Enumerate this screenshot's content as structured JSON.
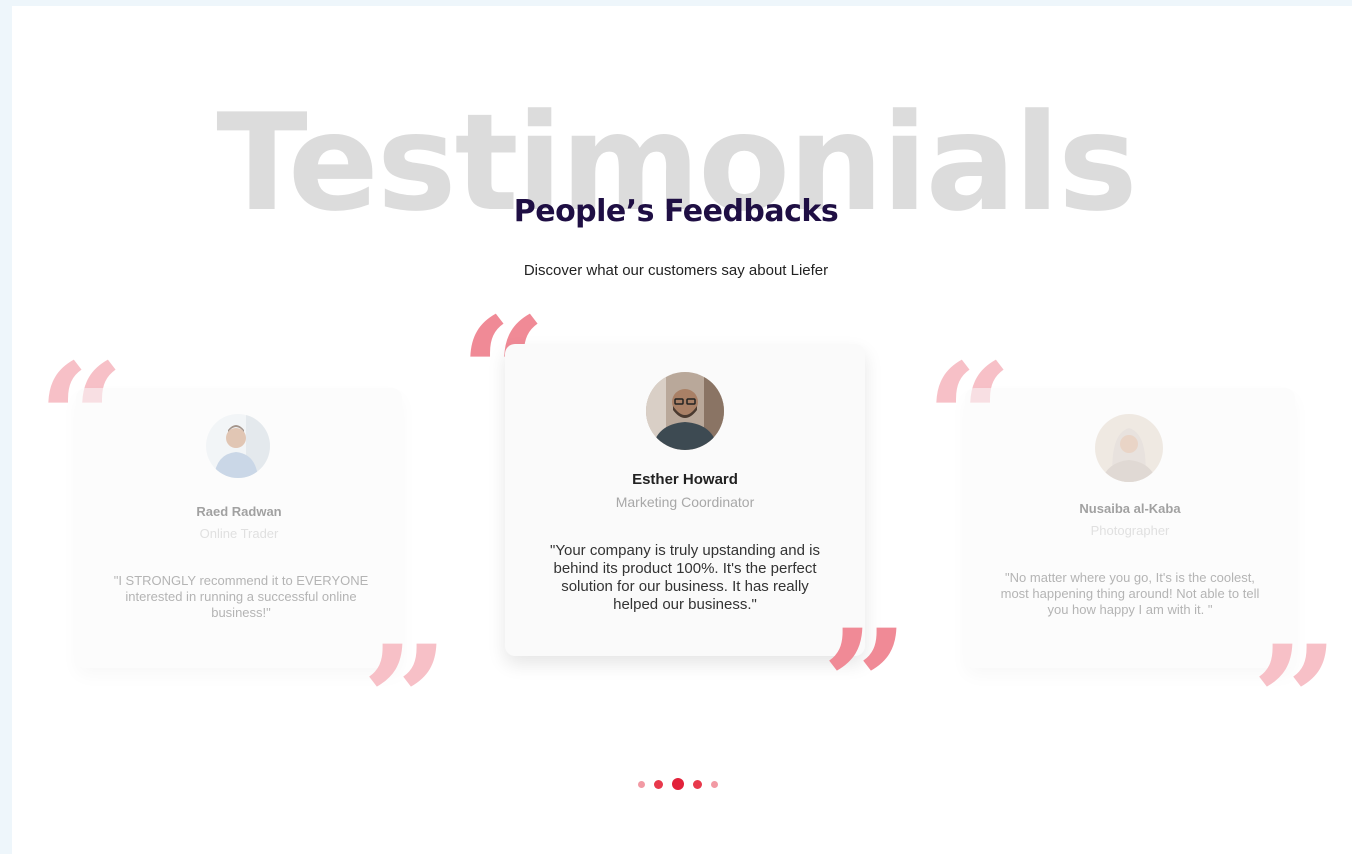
{
  "section": {
    "watermark": "Testimonials",
    "title": "People’s Feedbacks",
    "subtitle": "Discover what our customers say about Liefer"
  },
  "testimonials": [
    {
      "name": "Raed Radwan",
      "role": "Online Trader",
      "quote": "\"I STRONGLY recommend it to EVERYONE interested in running a successful online business!\"",
      "avatar_icon": "person-avatar"
    },
    {
      "name": "Esther Howard",
      "role": "Marketing Coordinator",
      "quote": "\"Your company is truly upstanding and is behind its product 100%. It's the perfect solution for our business. It has really helped our business.\"",
      "avatar_icon": "person-avatar"
    },
    {
      "name": "Nusaiba al-Kaba",
      "role": "Photographer",
      "quote": "\"No matter where you go, It's is the coolest, most happening thing around! Not able to tell you how happy I am with it. \"",
      "avatar_icon": "person-avatar"
    }
  ],
  "carousel": {
    "dot_count": 5,
    "active_index": 2
  },
  "colors": {
    "accent": "#e2213a",
    "quote_mark": "#f08a96",
    "title": "#1f0f44",
    "watermark": "#dcdcdc"
  },
  "glyphs": {
    "open_quote": "“",
    "close_quote": "”"
  }
}
